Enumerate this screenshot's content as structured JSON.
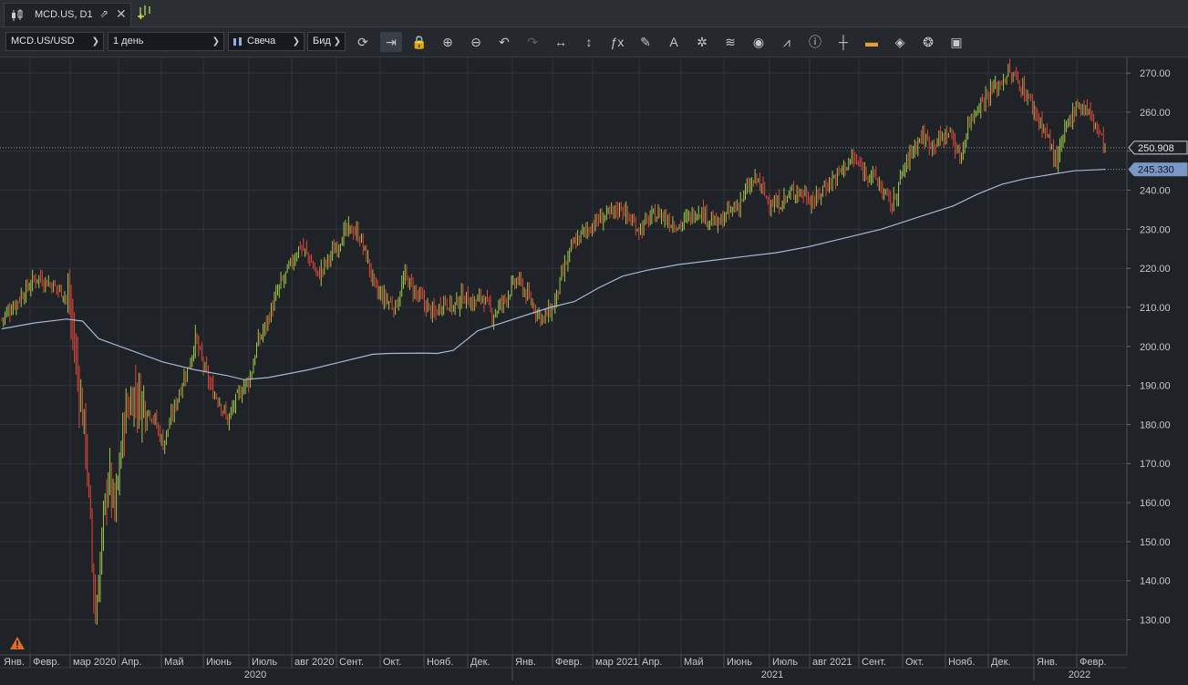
{
  "tab": {
    "title": "MCD.US, D1",
    "icon": "candlestick-icon",
    "popout_icon": "popout-icon",
    "close_icon": "close-icon",
    "new_tab_icon": "add-chart-icon"
  },
  "toolbar": {
    "instrument": "MCD.US/USD",
    "period": "1 день",
    "chart_type": "Свеча",
    "price_side": "Бид",
    "tools": [
      "refresh-icon",
      "shift-chart-icon",
      "lock-icon",
      "zoom-in-icon",
      "zoom-out-icon",
      "undo-icon",
      "redo-icon",
      "horizontal-scale-icon",
      "vertical-scale-icon",
      "indicators-fx-icon",
      "draw-pencil-icon",
      "text-tool-icon",
      "objects-icon",
      "layers-icon",
      "visibility-icon",
      "chart-compare-icon",
      "info-icon",
      "crosshair-icon",
      "theme-colors-icon",
      "paint-bucket-icon",
      "templates-icon",
      "save-icon"
    ]
  },
  "colors": {
    "background": "#1f2226",
    "grid": "#30343a",
    "bull": "#9cc94a",
    "bear": "#e0483c",
    "ma": "#a8b7d6",
    "axis_text": "#c5c9cf"
  },
  "chart_data": {
    "type": "candlestick",
    "instrument": "MCD.US/USD",
    "timeframe": "D1",
    "ylim": [
      121,
      274
    ],
    "y_ticks": [
      130,
      140,
      150,
      160,
      170,
      180,
      190,
      200,
      210,
      220,
      230,
      240,
      250,
      260,
      270
    ],
    "x_ticks": [
      "Янв.",
      "Февр.",
      "мар 2020",
      "Апр.",
      "Май",
      "Июнь",
      "Июль",
      "авг 2020",
      "Сент.",
      "Окт.",
      "Нояб.",
      "Дек.",
      "Янв.",
      "Февр.",
      "мар 2021",
      "Апр.",
      "Май",
      "Июнь",
      "Июль",
      "авг 2021",
      "Сент.",
      "Окт.",
      "Нояб.",
      "Дек.",
      "Янв.",
      "Февр."
    ],
    "years": [
      "2020",
      "2021",
      "2022"
    ],
    "last_price": "250.908",
    "ma_value": "245.330",
    "price_path": [
      [
        0,
        207
      ],
      [
        8,
        211
      ],
      [
        16,
        215
      ],
      [
        22,
        218
      ],
      [
        30,
        216
      ],
      [
        38,
        214
      ],
      [
        42,
        211
      ],
      [
        46,
        196
      ],
      [
        52,
        176
      ],
      [
        58,
        130
      ],
      [
        62,
        150
      ],
      [
        66,
        168
      ],
      [
        70,
        157
      ],
      [
        76,
        182
      ],
      [
        82,
        188
      ],
      [
        88,
        185
      ],
      [
        94,
        182
      ],
      [
        100,
        175
      ],
      [
        106,
        183
      ],
      [
        112,
        191
      ],
      [
        116,
        195
      ],
      [
        120,
        202
      ],
      [
        125,
        195
      ],
      [
        130,
        189
      ],
      [
        135,
        186
      ],
      [
        140,
        181
      ],
      [
        145,
        186
      ],
      [
        150,
        190
      ],
      [
        154,
        192
      ],
      [
        158,
        200
      ],
      [
        165,
        207
      ],
      [
        172,
        215
      ],
      [
        178,
        220
      ],
      [
        185,
        226
      ],
      [
        190,
        223
      ],
      [
        196,
        218
      ],
      [
        202,
        222
      ],
      [
        208,
        226
      ],
      [
        212,
        229
      ],
      [
        218,
        230
      ],
      [
        222,
        228
      ],
      [
        226,
        223
      ],
      [
        232,
        214
      ],
      [
        238,
        212
      ],
      [
        244,
        210
      ],
      [
        250,
        218
      ],
      [
        256,
        214
      ],
      [
        262,
        211
      ],
      [
        268,
        208
      ],
      [
        274,
        212
      ],
      [
        280,
        210
      ],
      [
        286,
        213
      ],
      [
        292,
        211
      ],
      [
        298,
        213
      ],
      [
        304,
        208
      ],
      [
        310,
        211
      ],
      [
        316,
        215
      ],
      [
        320,
        217
      ],
      [
        324,
        214
      ],
      [
        330,
        210
      ],
      [
        336,
        207
      ],
      [
        342,
        210
      ],
      [
        348,
        219
      ],
      [
        354,
        226
      ],
      [
        360,
        229
      ],
      [
        366,
        231
      ],
      [
        372,
        233
      ],
      [
        378,
        234
      ],
      [
        384,
        236
      ],
      [
        390,
        232
      ],
      [
        396,
        230
      ],
      [
        402,
        233
      ],
      [
        408,
        234
      ],
      [
        414,
        232
      ],
      [
        420,
        231
      ],
      [
        426,
        233
      ],
      [
        432,
        235
      ],
      [
        438,
        233
      ],
      [
        444,
        231
      ],
      [
        450,
        234
      ],
      [
        456,
        236
      ],
      [
        462,
        240
      ],
      [
        468,
        243
      ],
      [
        474,
        238
      ],
      [
        480,
        236
      ],
      [
        486,
        238
      ],
      [
        492,
        240
      ],
      [
        498,
        239
      ],
      [
        504,
        237
      ],
      [
        510,
        241
      ],
      [
        516,
        243
      ],
      [
        522,
        246
      ],
      [
        528,
        248
      ],
      [
        534,
        245
      ],
      [
        540,
        244
      ],
      [
        546,
        240
      ],
      [
        552,
        236
      ],
      [
        558,
        244
      ],
      [
        564,
        250
      ],
      [
        570,
        254
      ],
      [
        576,
        252
      ],
      [
        582,
        253
      ],
      [
        588,
        255
      ],
      [
        594,
        248
      ],
      [
        600,
        258
      ],
      [
        606,
        262
      ],
      [
        612,
        265
      ],
      [
        618,
        267
      ],
      [
        624,
        270
      ],
      [
        630,
        268
      ],
      [
        636,
        264
      ],
      [
        642,
        259
      ],
      [
        648,
        254
      ],
      [
        654,
        247
      ],
      [
        660,
        256
      ],
      [
        666,
        262
      ],
      [
        672,
        261
      ],
      [
        678,
        257
      ],
      [
        684,
        251
      ]
    ],
    "moving_average_path": [
      [
        0,
        204.5
      ],
      [
        20,
        206
      ],
      [
        40,
        207
      ],
      [
        50,
        206.5
      ],
      [
        60,
        202
      ],
      [
        80,
        199
      ],
      [
        100,
        196
      ],
      [
        120,
        194
      ],
      [
        140,
        192.5
      ],
      [
        150,
        191.5
      ],
      [
        165,
        192
      ],
      [
        190,
        194
      ],
      [
        210,
        196
      ],
      [
        230,
        198
      ],
      [
        240,
        198.2
      ],
      [
        260,
        198.3
      ],
      [
        270,
        198.2
      ],
      [
        280,
        199
      ],
      [
        295,
        204
      ],
      [
        310,
        206
      ],
      [
        325,
        208
      ],
      [
        340,
        210
      ],
      [
        355,
        211.5
      ],
      [
        370,
        215
      ],
      [
        385,
        218
      ],
      [
        400,
        219.5
      ],
      [
        420,
        221
      ],
      [
        440,
        222
      ],
      [
        460,
        223
      ],
      [
        480,
        224
      ],
      [
        500,
        225.5
      ],
      [
        515,
        227
      ],
      [
        530,
        228.5
      ],
      [
        545,
        230
      ],
      [
        560,
        232
      ],
      [
        575,
        234
      ],
      [
        590,
        236
      ],
      [
        605,
        239
      ],
      [
        620,
        241.5
      ],
      [
        635,
        243
      ],
      [
        650,
        244
      ],
      [
        665,
        245
      ],
      [
        684,
        245.33
      ]
    ],
    "x_units": "trading-day index"
  },
  "warning_icon": "warning-icon"
}
